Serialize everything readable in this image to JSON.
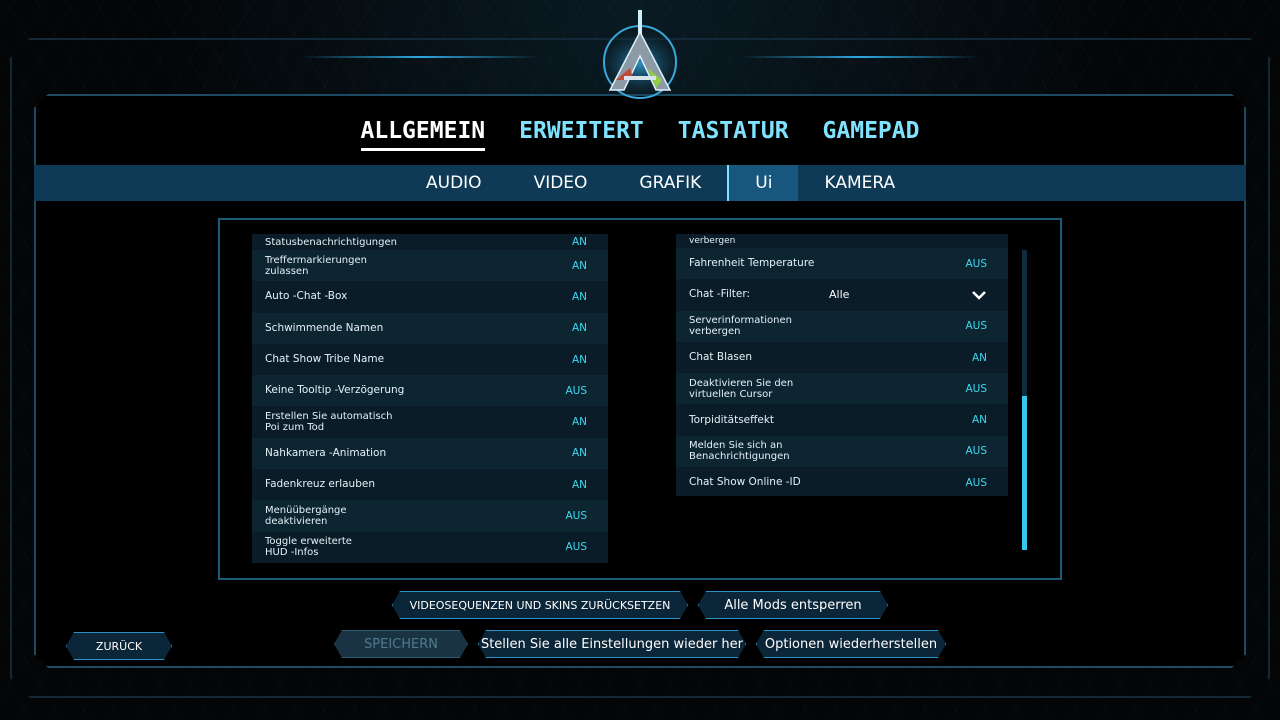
{
  "top_tabs": [
    {
      "label": "ALLGEMEIN",
      "active": true
    },
    {
      "label": "ERWEITERT",
      "active": false
    },
    {
      "label": "TASTATUR",
      "active": false
    },
    {
      "label": "GAMEPAD",
      "active": false
    }
  ],
  "sub_tabs": [
    {
      "label": "AUDIO",
      "active": false
    },
    {
      "label": "VIDEO",
      "active": false
    },
    {
      "label": "GRAFIK",
      "active": false
    },
    {
      "label": "Ui",
      "active": true
    },
    {
      "label": "KAMERA",
      "active": false
    }
  ],
  "left_list": [
    {
      "label": "Statusbenachrichtigungen",
      "value": "AN"
    },
    {
      "label": "Treffermarkierungen zulassen",
      "value": "AN"
    },
    {
      "label": "Auto -Chat -Box",
      "value": "AN"
    },
    {
      "label": "Schwimmende Namen",
      "value": "AN"
    },
    {
      "label": "Chat Show Tribe Name",
      "value": "AN"
    },
    {
      "label": "Keine Tooltip -Verzögerung",
      "value": "AUS"
    },
    {
      "label": "Erstellen Sie automatisch Poi zum Tod",
      "value": "AN"
    },
    {
      "label": "Nahkamera -Animation",
      "value": "AN"
    },
    {
      "label": "Fadenkreuz erlauben",
      "value": "AN"
    },
    {
      "label": "Menüübergänge deaktivieren",
      "value": "AUS"
    },
    {
      "label": "Toggle erweiterte HUD -Infos",
      "value": "AUS"
    }
  ],
  "right_list": [
    {
      "label": "verbergen",
      "value": ""
    },
    {
      "label": "Fahrenheit Temperature",
      "value": "AUS"
    },
    {
      "label": "Chat -Filter:",
      "value": "Alle"
    },
    {
      "label": "Serverinformationen verbergen",
      "value": "AUS"
    },
    {
      "label": "Chat Blasen",
      "value": "AN"
    },
    {
      "label": "Deaktivieren Sie den virtuellen Cursor",
      "value": "AUS"
    },
    {
      "label": "Torpiditätseffekt",
      "value": "AN"
    },
    {
      "label": "Melden Sie sich an Benachrichtigungen",
      "value": "AUS"
    },
    {
      "label": "Chat Show Online -ID",
      "value": "AUS"
    }
  ],
  "scroll": {
    "position": 0.49,
    "visible_fraction": 0.51
  },
  "buttons": {
    "reset_videos": "VIDEOSEQUENZEN UND SKINS ZURÜCKSETZEN",
    "unlock_mods": "Alle Mods entsperren",
    "back": "ZURÜCK",
    "save": "SPEICHERN",
    "restore_all": "Stellen Sie alle Einstellungen wieder her",
    "restore_options": "Optionen wiederherstellen"
  },
  "colors": {
    "accent": "#7fe3ff",
    "value": "#3fd9f0",
    "bar": "#0e3a55"
  }
}
